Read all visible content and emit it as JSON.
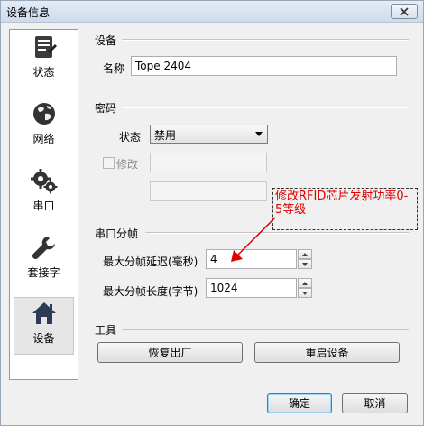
{
  "window": {
    "title": "设备信息"
  },
  "sidebar": {
    "items": [
      {
        "label": "状态",
        "icon": "status-document-icon"
      },
      {
        "label": "网络",
        "icon": "globe-icon"
      },
      {
        "label": "串口",
        "icon": "gears-icon"
      },
      {
        "label": "套接字",
        "icon": "wrench-icon"
      },
      {
        "label": "设备",
        "icon": "house-icon"
      }
    ],
    "selected": "设备"
  },
  "device_section": {
    "title": "设备",
    "name_label": "名称",
    "name_value": "Tope 2404"
  },
  "password_section": {
    "title": "密码",
    "status_label": "状态",
    "status_value": "禁用",
    "modify_label": "修改",
    "modify_checked": false,
    "field1_value": "",
    "field2_value": ""
  },
  "serial_section": {
    "title": "串口分帧",
    "delay_label": "最大分帧延迟(毫秒)",
    "delay_value": "4",
    "length_label": "最大分帧长度(字节)",
    "length_value": "1024"
  },
  "tools_section": {
    "title": "工具",
    "restore_label": "恢复出厂",
    "restart_label": "重启设备"
  },
  "footer": {
    "ok_label": "确定",
    "cancel_label": "取消"
  },
  "annotation": {
    "text": "修改RFID芯片发射功率0-5等级",
    "color": "#e00000"
  }
}
